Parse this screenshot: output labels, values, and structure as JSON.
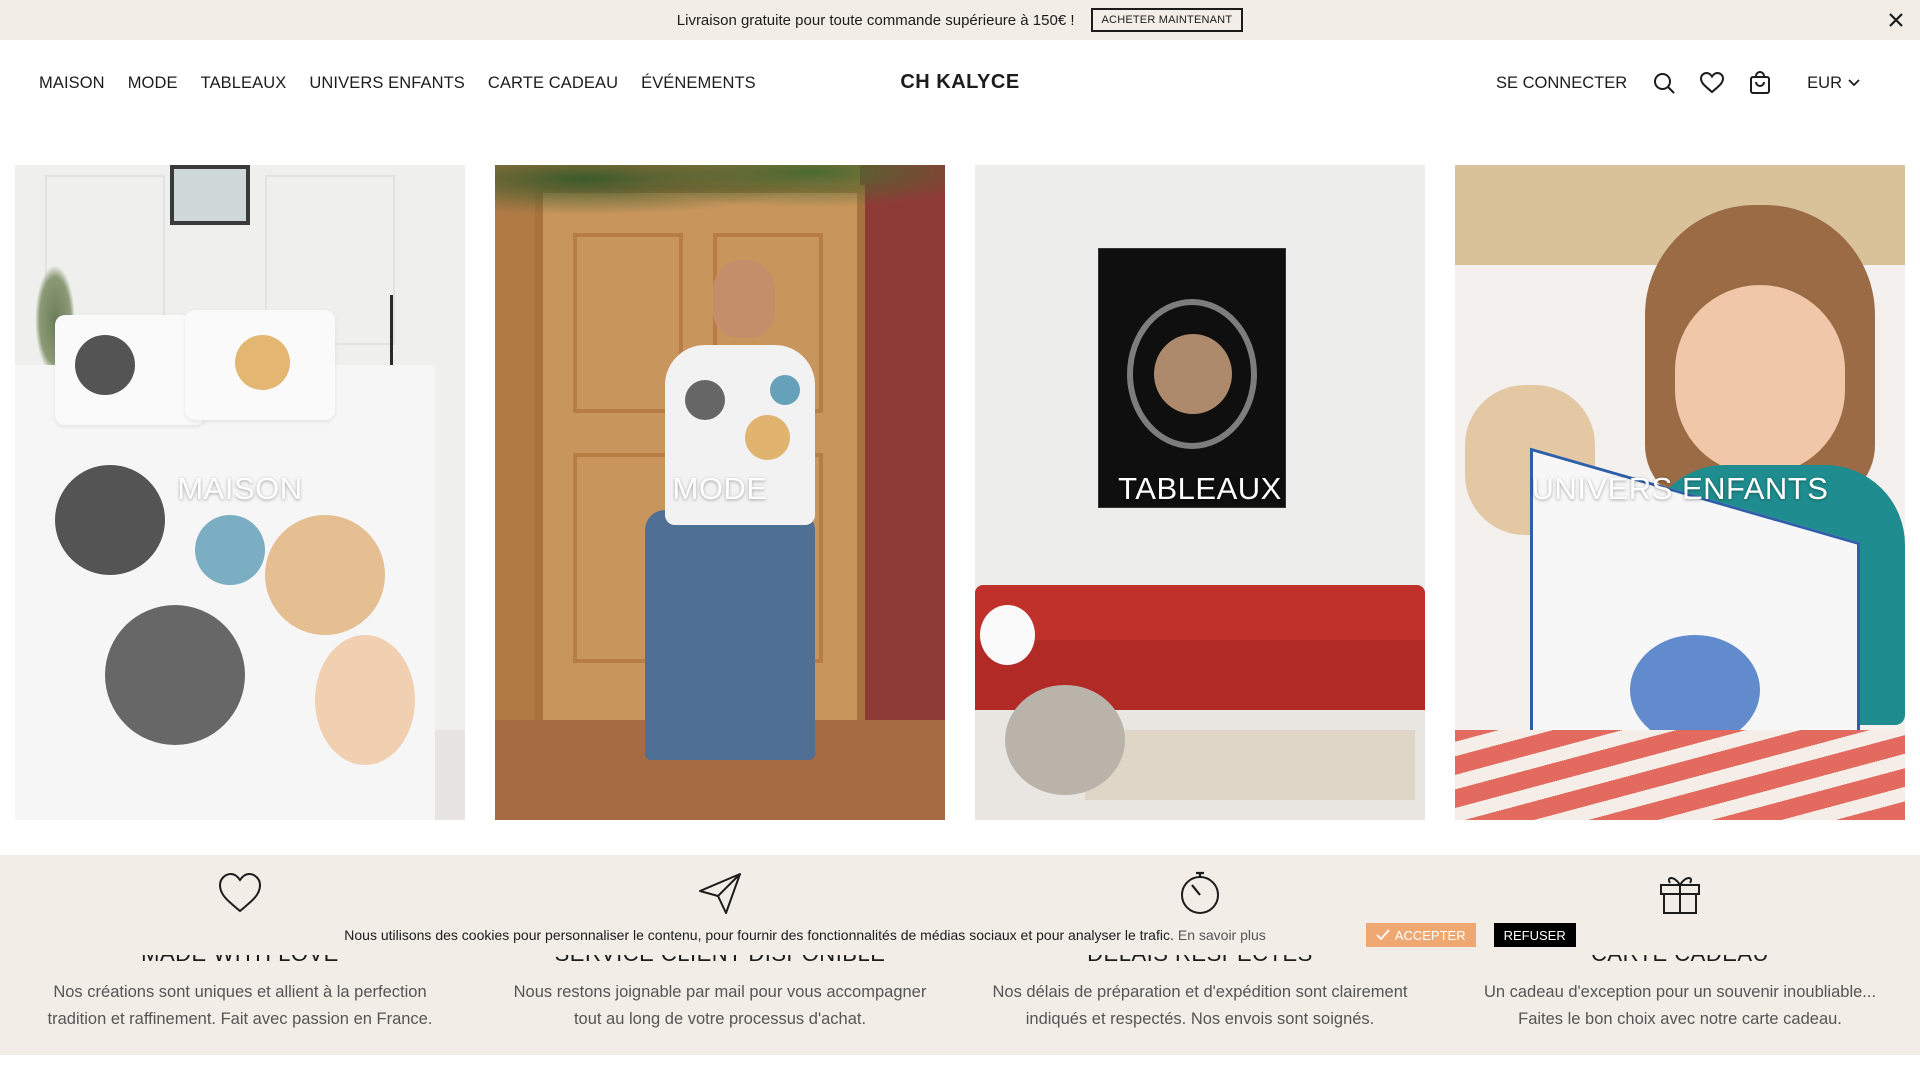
{
  "announcement": {
    "message": "Livraison gratuite pour toute commande supérieure à 150€ !",
    "cta_label": "ACHETER MAINTENANT",
    "close_icon": "close-icon"
  },
  "header": {
    "nav": [
      "MAISON",
      "MODE",
      "TABLEAUX",
      "UNIVERS ENFANTS",
      "CARTE CADEAU",
      "ÉVÉNEMENTS"
    ],
    "logo": "CH KALYCE",
    "login_label": "SE CONNECTER",
    "icons": [
      "search-icon",
      "heart-icon",
      "bag-icon"
    ],
    "currency": "EUR"
  },
  "categories": [
    {
      "label": "MAISON"
    },
    {
      "label": "MODE"
    },
    {
      "label": "TABLEAUX"
    },
    {
      "label": "UNIVERS ENFANTS"
    }
  ],
  "features": [
    {
      "icon": "heart-icon",
      "title": "MADE WITH LOVE",
      "desc": "Nos créations sont uniques et allient à la perfection tradition et raffinement. Fait avec passion en France."
    },
    {
      "icon": "paper-plane-icon",
      "title": "SERVICE CLIENT DISPONIBLE",
      "desc": "Nous restons joignable par mail pour vous accompagner tout au long de votre processus d'achat."
    },
    {
      "icon": "stopwatch-icon",
      "title": "DÉLAIS RESPECTÉS",
      "desc": "Nos délais de préparation et d'expédition sont clairement indiqués et respectés. Nos envois sont soignés."
    },
    {
      "icon": "gift-icon",
      "title": "CARTE CADEAU",
      "desc": "Un cadeau d'exception pour un souvenir inoubliable... Faites le bon choix avec notre carte cadeau."
    }
  ],
  "cookie": {
    "text": "Nous utilisons des cookies pour personnaliser le contenu, pour fournir des fonctionnalités de médias sociaux et pour analyser le trafic.",
    "more_label": "En savoir plus",
    "accept_label": "ACCEPTER",
    "refuse_label": "REFUSER"
  },
  "colors": {
    "accent_beige": "#f2ede6",
    "accept_orange": "#f0a872",
    "text_dark": "#1c1c1c"
  }
}
